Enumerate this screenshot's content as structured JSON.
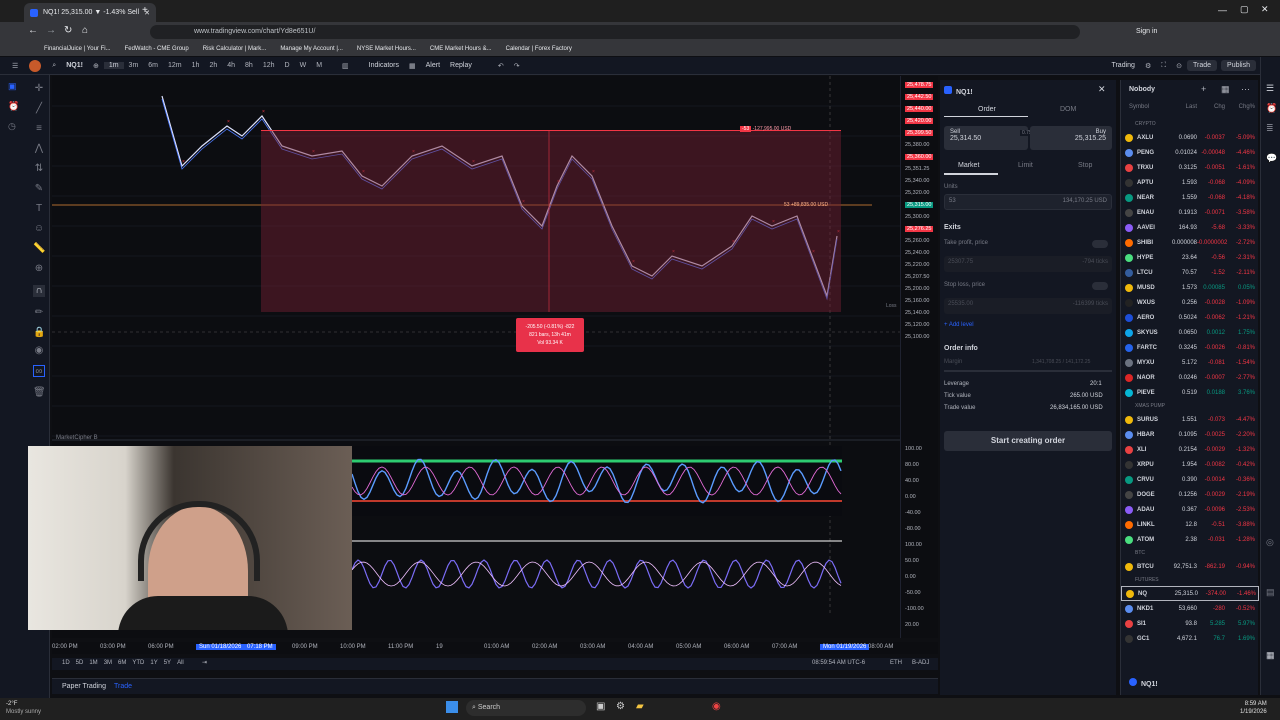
{
  "browser": {
    "tab_title": "NQ1! 25,315.00 ▼ -1.43% Sell",
    "url": "www.tradingview.com/chart/Yd8e651U/",
    "bookmarks": [
      "FinancialJuice | Your Fi...",
      "FedWatch - CME Group",
      "Risk Calculator | Mark...",
      "Manage My Account |...",
      "NYSE Market Hours...",
      "CME Market Hours &...",
      "Calendar | Forex Factory"
    ],
    "signin": "Sign in"
  },
  "toolbar": {
    "symbol": "NQ1!",
    "intervals": [
      "1m",
      "3m",
      "6m",
      "12m",
      "1h",
      "2h",
      "4h",
      "8h",
      "12h",
      "D",
      "W",
      "M"
    ],
    "indicators": "Indicators",
    "alert": "Alert",
    "replay": "Replay",
    "trading": "Trading",
    "publish": "Publish"
  },
  "chart": {
    "position_labels": {
      "top": "-53",
      "top_value": "-127,995.00 USD",
      "mid": "53",
      "mid_value": "+89,835.00 USD",
      "loss": "Loss"
    },
    "measure": {
      "line1": "-205.50 (-0.81%) -822",
      "line2": "821 bars, 13h 41m",
      "line3": "Vol 93.34 K"
    },
    "price_labels": [
      "25,478.75",
      "25,442.50",
      "25,440.00",
      "25,420.00",
      "25,399.50",
      "25,380.00",
      "25,360.00",
      "25,351.25",
      "25,340.00",
      "25,320.00",
      "25,315.00",
      "25,300.00",
      "25,276.25",
      "25,260.00",
      "25,240.00",
      "25,220.00",
      "25,207.50",
      "25,200.00",
      "25,160.00",
      "25,140.00",
      "25,120.00",
      "25,100.00"
    ],
    "osc_labels": [
      "100.00",
      "80.00",
      "40.00",
      "0.00",
      "-40.00",
      "-80.00",
      "100.00",
      "50.00",
      "0.00",
      "-50.00",
      "-100.00",
      "20.00"
    ],
    "indicator_title": "MarketCipher B",
    "time_labels": [
      "02:00 PM",
      "03:00 PM",
      "06:00 PM",
      "Sun 01/18/2026",
      "07:18 PM",
      "09:00 PM",
      "10:00 PM",
      "11:00 PM",
      "19",
      "01:00 AM",
      "02:00 AM",
      "03:00 AM",
      "04:00 AM",
      "05:00 AM",
      "06:00 AM",
      "07:00 AM",
      "Mon 01/19/2026",
      "08:00 AM"
    ],
    "ranges": [
      "1D",
      "5D",
      "1M",
      "3M",
      "6M",
      "YTD",
      "1Y",
      "5Y",
      "All"
    ],
    "clock": "08:59:54 AM UTC-6",
    "session": "ETH",
    "adj": "B-ADJ"
  },
  "bottom_tabs": {
    "paper": "Paper Trading",
    "trade": "Trade"
  },
  "order": {
    "symbol": "NQ1!",
    "tabs": [
      "Order",
      "DOM"
    ],
    "sell_label": "Sell",
    "sell_price": "25,314.50",
    "spread": "0.75",
    "buy_label": "Buy",
    "buy_price": "25,315.25",
    "types": [
      "Market",
      "Limit",
      "Stop"
    ],
    "units_label": "Units",
    "units_value": "53",
    "units_usd": "134,170.25 USD",
    "exits": "Exits",
    "take_profit": "Take profit, price",
    "tp_value": "25307.75",
    "tp_pts": "-794 ticks",
    "stop_loss": "Stop loss, price",
    "sl_value": "25535.00",
    "sl_pts": "-116399 ticks",
    "add_level": "Add level",
    "order_info": "Order info",
    "margin_label": "Margin",
    "margin_value": "1,341,708.25 / 141,172.25",
    "leverage_label": "Leverage",
    "leverage_value": "20:1",
    "tick_label": "Tick value",
    "tick_value": "265.00 USD",
    "trade_label": "Trade value",
    "trade_value": "26,834,165.00 USD",
    "submit": "Start creating order"
  },
  "watchlist": {
    "title": "Nobody",
    "cols": [
      "Symbol",
      "Last",
      "Chg",
      "Chg%"
    ],
    "sections": [
      "CRYPTO",
      "XMAS PUMP",
      "BTC",
      "FUTURES"
    ],
    "crypto": [
      [
        "AXLU",
        "0.0690",
        "-0.0037",
        "-5.09%"
      ],
      [
        "PENG",
        "0.01024",
        "-0.00048",
        "-4.46%"
      ],
      [
        "TRXU",
        "0.3125",
        "-0.0051",
        "-1.61%"
      ],
      [
        "APTU",
        "1.593",
        "-0.068",
        "-4.09%"
      ],
      [
        "NEAR",
        "1.559",
        "-0.068",
        "-4.18%"
      ],
      [
        "ENAU",
        "0.1913",
        "-0.0071",
        "-3.58%"
      ],
      [
        "AAVEI",
        "164.93",
        "-5.68",
        "-3.33%"
      ],
      [
        "SHIBI",
        "0.000008",
        "-0.0000002",
        "-2.72%"
      ],
      [
        "HYPE",
        "23.64",
        "-0.56",
        "-2.31%"
      ],
      [
        "LTCU",
        "70.57",
        "-1.52",
        "-2.11%"
      ],
      [
        "MUSD",
        "1.573",
        "0.00085",
        "0.05%"
      ],
      [
        "WXUS",
        "0.256",
        "-0.0028",
        "-1.09%"
      ],
      [
        "AERO",
        "0.5024",
        "-0.0062",
        "-1.21%"
      ],
      [
        "SKYUS",
        "0.0650",
        "0.0012",
        "1.75%"
      ],
      [
        "FARTC",
        "0.3245",
        "-0.0026",
        "-0.81%"
      ],
      [
        "MYXU",
        "5.172",
        "-0.081",
        "-1.54%"
      ],
      [
        "NAOR",
        "0.0246",
        "-0.0007",
        "-2.77%"
      ],
      [
        "PIEVE",
        "0.519",
        "0.0188",
        "3.76%"
      ]
    ],
    "xmas": [
      [
        "SURUS",
        "1.551",
        "-0.073",
        "-4.47%"
      ],
      [
        "HBAR",
        "0.1095",
        "-0.0025",
        "-2.20%"
      ],
      [
        "XLI",
        "0.2154",
        "-0.0029",
        "-1.32%"
      ],
      [
        "XRPU",
        "1.954",
        "-0.0082",
        "-0.42%"
      ],
      [
        "CRVU",
        "0.390",
        "-0.0014",
        "-0.36%"
      ],
      [
        "DOGE",
        "0.1256",
        "-0.0029",
        "-2.19%"
      ],
      [
        "ADAU",
        "0.367",
        "-0.0096",
        "-2.53%"
      ],
      [
        "LINKL",
        "12.8",
        "-0.51",
        "-3.88%"
      ],
      [
        "ATOM",
        "2.38",
        "-0.031",
        "-1.28%"
      ]
    ],
    "btc": [
      [
        "BTCU",
        "92,751.3",
        "-862.19",
        "-0.94%"
      ]
    ],
    "futures": [
      [
        "NQ",
        "25,315.0",
        "-374.00",
        "-1.46%"
      ],
      [
        "NKD1",
        "53,660",
        "-280",
        "-0.52%"
      ],
      [
        "SI1",
        "93.8",
        "5.285",
        "5.97%"
      ],
      [
        "GC1",
        "4,672.1",
        "76.7",
        "1.69%"
      ]
    ],
    "footer": "NQ1!"
  },
  "taskbar": {
    "weather_temp": "-2°F",
    "weather_desc": "Mostly sunny",
    "search": "Search",
    "time": "8:59 AM",
    "date": "1/19/2026"
  },
  "colors": {
    "bg": "#0c0d11",
    "red": "#f23645",
    "green": "#089981",
    "zone": "#4a1722",
    "blue": "#2962ff"
  }
}
